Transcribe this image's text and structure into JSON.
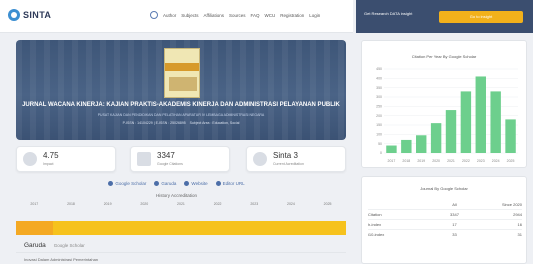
{
  "header": {
    "logo_text": "SINTA",
    "menu": [
      "Author",
      "Subjects",
      "Affiliations",
      "Sources",
      "FAQ",
      "WCU",
      "Registration",
      "Login"
    ]
  },
  "right_header": {
    "text": "Get Research DATA insight",
    "button": "Go to insight"
  },
  "journal": {
    "title": "JURNAL WACANA KINERJA: KAJIAN PRAKTIS-AKADEMIS KINERJA DAN ADMINISTRASI PELAYANAN PUBLIK",
    "affiliation": "PUSAT KAJIAN DAN PENDIDIKAN DAN PELATIHAN APARATUR IV LEMBAGA ADMINISTRASI NEGARA",
    "issn": "P-ISSN : 14104229 | E-ISSN : 25026895",
    "subject": "Subject Area : Education, Social"
  },
  "stats": [
    {
      "value": "4.75",
      "label": "Impact"
    },
    {
      "value": "3347",
      "label": "Google Citations"
    },
    {
      "value": "Sinta 3",
      "label": "Current Acreditation"
    }
  ],
  "links": [
    "Google Scholar",
    "Garuda",
    "Website",
    "Editor URL"
  ],
  "history": {
    "label": "History Accreditation",
    "years": [
      "2017",
      "2018",
      "2019",
      "2020",
      "2021",
      "2022",
      "2023",
      "2024",
      "2025"
    ]
  },
  "tabs": {
    "active": "Garuda",
    "other": "Google Scholar"
  },
  "footer_text": "Inovasi Dalam Administrasi Pemerintahan",
  "chart_card": {
    "title": "Citation Per Year By Google Scholar"
  },
  "chart_data": {
    "type": "bar",
    "title": "Citation Per Year By Google Scholar",
    "categories": [
      "2017",
      "2018",
      "2019",
      "2020",
      "2021",
      "2022",
      "2023",
      "2024",
      "2025"
    ],
    "values": [
      40,
      70,
      95,
      160,
      230,
      330,
      410,
      330,
      180
    ],
    "ylim": [
      0,
      450
    ],
    "yticks": [
      "0",
      "50",
      "100",
      "150",
      "200",
      "250",
      "300",
      "350",
      "400",
      "450"
    ],
    "grid": true,
    "color": "#6dcf8d"
  },
  "table_card": {
    "title": "Journal By Google Scholar",
    "headers": [
      "",
      "All",
      "Since 2020"
    ],
    "rows": [
      {
        "label": "Citation",
        "all": "3347",
        "since": "2944"
      },
      {
        "label": "h-index",
        "all": "17",
        "since": "16"
      },
      {
        "label": "i10-index",
        "all": "33",
        "since": "31"
      }
    ]
  },
  "colors": {
    "accent": "#3b4e6f",
    "yellow": "#f6c21d",
    "orange": "#f4a923",
    "link": "#4c6ea8"
  }
}
